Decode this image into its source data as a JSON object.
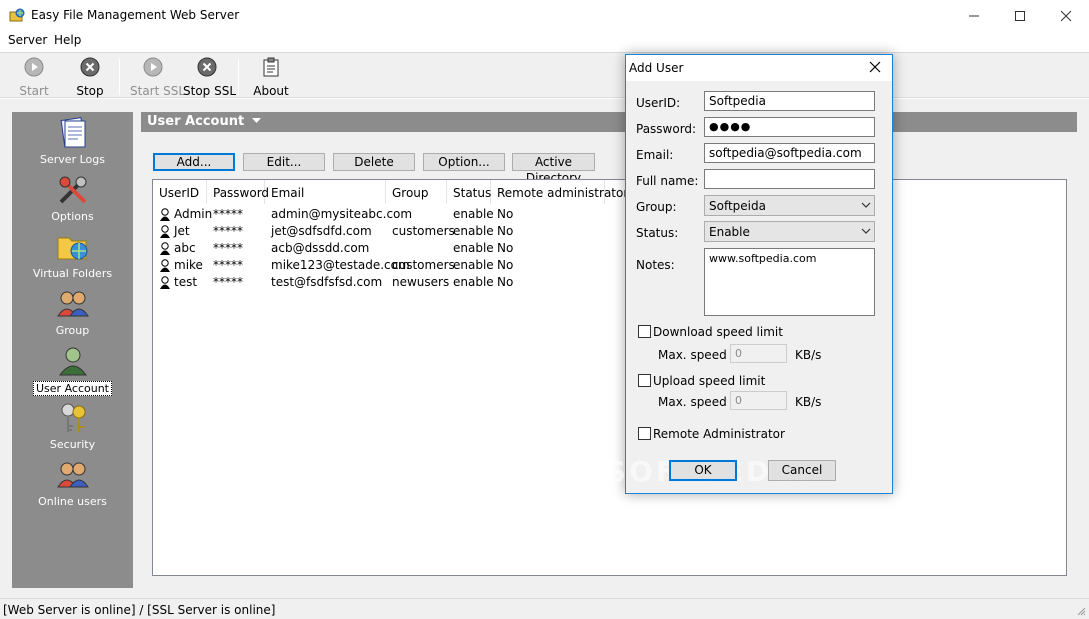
{
  "window": {
    "title": "Easy File Management Web Server"
  },
  "menu": [
    "Server",
    "Help"
  ],
  "toolbar": {
    "start": "Start",
    "stop": "Stop",
    "start_ssl": "Start SSL",
    "stop_ssl": "Stop SSL",
    "about": "About"
  },
  "sidebar": {
    "items": [
      {
        "label": "Server Logs",
        "icon": "server-logs-icon"
      },
      {
        "label": "Options",
        "icon": "tools-icon"
      },
      {
        "label": "Virtual Folders",
        "icon": "folder-globe-icon"
      },
      {
        "label": "Group",
        "icon": "group-icon"
      },
      {
        "label": "User Account",
        "icon": "user-icon",
        "active": true
      },
      {
        "label": "Security",
        "icon": "keys-icon"
      },
      {
        "label": "Online users",
        "icon": "online-users-icon"
      }
    ]
  },
  "content": {
    "header": "User Account",
    "buttons": {
      "add": "Add...",
      "edit": "Edit...",
      "delete": "Delete",
      "option": "Option...",
      "active_directory": "Active Directory"
    },
    "columns": [
      "UserID",
      "Password",
      "Email",
      "Group",
      "Status",
      "Remote administrator"
    ],
    "rows": [
      [
        "Admin",
        "*****",
        "admin@mysiteabc.com",
        "",
        "enable",
        "No"
      ],
      [
        "Jet",
        "*****",
        "jet@sdfsdfd.com",
        "customers",
        "enable",
        "No"
      ],
      [
        "abc",
        "*****",
        "acb@dssdd.com",
        "",
        "enable",
        "No"
      ],
      [
        "mike",
        "*****",
        "mike123@testade.com",
        "customers",
        "enable",
        "No"
      ],
      [
        "test",
        "*****",
        "test@fsdfsfsd.com",
        "newusers",
        "enable",
        "No"
      ]
    ]
  },
  "status_bar": "[Web Server is online] / [SSL Server is online]",
  "dialog": {
    "title": "Add User",
    "labels": {
      "userid": "UserID:",
      "password": "Password:",
      "email": "Email:",
      "fullname": "Full name:",
      "group": "Group:",
      "status": "Status:",
      "notes": "Notes:"
    },
    "values": {
      "userid": "Softpedia",
      "password": "●●●●",
      "email": "softpedia@softpedia.com",
      "fullname": "",
      "group": "Softpeida",
      "status": "Enable",
      "notes": "www.softpedia.com"
    },
    "download_limit": {
      "label": "Download speed limit",
      "checked": false,
      "speed_label": "Max. speed",
      "speed": "0",
      "unit": "KB/s"
    },
    "upload_limit": {
      "label": "Upload speed limit",
      "checked": false,
      "speed_label": "Max. speed",
      "speed": "0",
      "unit": "KB/s"
    },
    "remote_admin": {
      "label": "Remote Administrator",
      "checked": false
    },
    "ok": "OK",
    "cancel": "Cancel",
    "watermark": "SOFTPEDIA"
  }
}
